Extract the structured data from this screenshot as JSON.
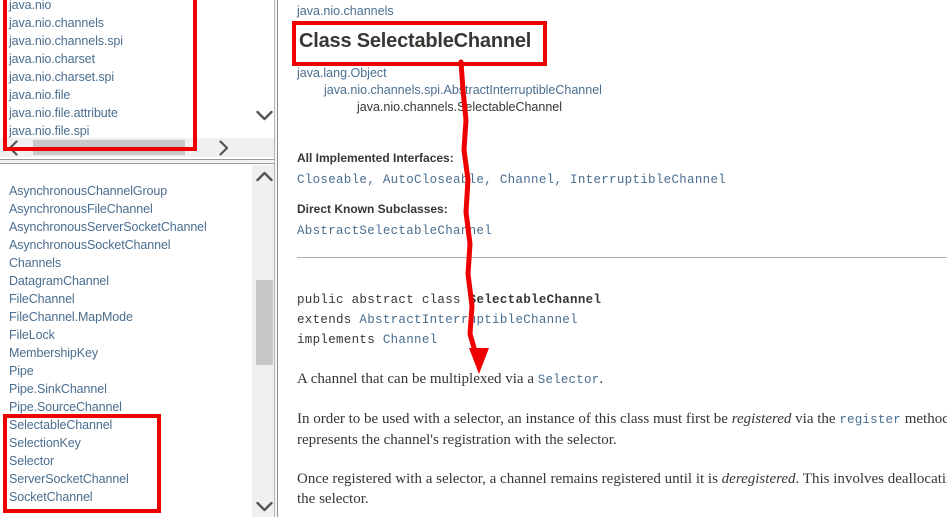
{
  "left_panel": {
    "package_list": {
      "name": "package-list",
      "items": [
        "java.nio",
        "java.nio.channels",
        "java.nio.channels.spi",
        "java.nio.charset",
        "java.nio.charset.spi",
        "java.nio.file",
        "java.nio.file.attribute",
        "java.nio.file.spi"
      ]
    },
    "class_list": {
      "name": "class-list",
      "items": [
        "AsynchronousChannelGroup",
        "AsynchronousFileChannel",
        "AsynchronousServerSocketChannel",
        "AsynchronousSocketChannel",
        "Channels",
        "DatagramChannel",
        "FileChannel",
        "FileChannel.MapMode",
        "FileLock",
        "MembershipKey",
        "Pipe",
        "Pipe.SinkChannel",
        "Pipe.SourceChannel",
        "SelectableChannel",
        "SelectionKey",
        "Selector",
        "ServerSocketChannel",
        "SocketChannel"
      ]
    }
  },
  "content": {
    "package_name": "java.nio.channels",
    "class_title": "Class SelectableChannel",
    "inheritance": [
      "java.lang.Object",
      "java.nio.channels.spi.AbstractInterruptibleChannel",
      "java.nio.channels.SelectableChannel"
    ],
    "implemented_interfaces_label": "All Implemented Interfaces:",
    "implemented_interfaces": "Closeable, AutoCloseable, Channel, InterruptibleChannel",
    "direct_subclasses_label": "Direct Known Subclasses:",
    "direct_subclasses": "AbstractSelectableChannel",
    "signature": {
      "line1_modifiers": "public abstract class ",
      "line1_name": "SelectableChannel",
      "line2_keyword": "extends ",
      "line2_type": "AbstractInterruptibleChannel",
      "line3_keyword": "implements ",
      "line3_type": "Channel"
    },
    "paragraphs": [
      {
        "prefix": "A channel that can be multiplexed via a ",
        "code": "Selector",
        "suffix": "."
      },
      {
        "prefix": "In order to be used with a selector, an instance of this class must first be ",
        "italic": "registered",
        "middle": " via the ",
        "code": "register",
        "suffix": " method. This method returns an object called a selection key, which",
        "line2": "represents the channel's registration with the selector."
      },
      {
        "prefix": "Once registered with a selector, a channel remains registered until it is ",
        "italic": "deregistered",
        "suffix": ". This involves deallocating whatever resources were allocated to the channel by",
        "line2": "the selector."
      }
    ]
  },
  "annotations": {
    "highlight_color": "#ee0000",
    "boxes": [
      {
        "name": "package-list-highlight"
      },
      {
        "name": "class-title-highlight"
      },
      {
        "name": "selectable-classes-highlight"
      }
    ],
    "arrow": {
      "name": "title-to-description-arrow"
    }
  },
  "scrollbars": {
    "package_vertical": "scrollbar",
    "package_horizontal": "scrollbar",
    "class_vertical": "scrollbar"
  }
}
